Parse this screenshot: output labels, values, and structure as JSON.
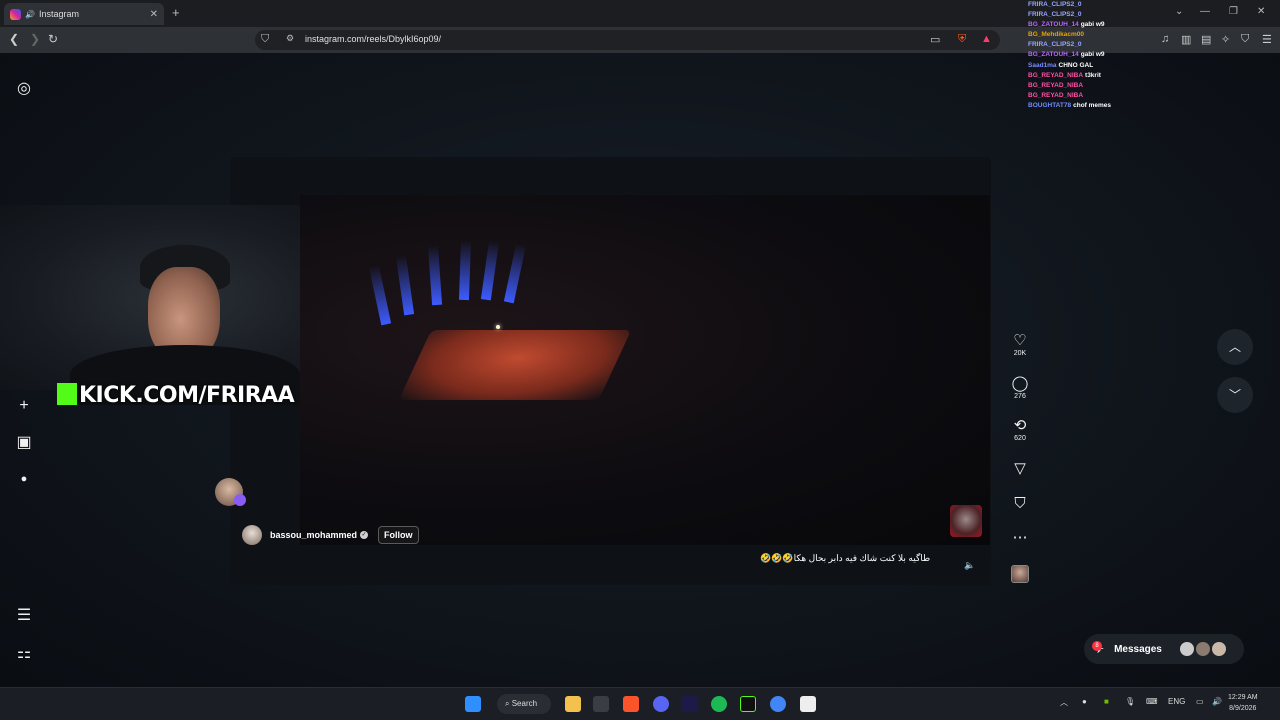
{
  "browser": {
    "tab_title": "Instagram",
    "url": "instagram.com/reels/DbylkI6op09/"
  },
  "chat": [
    {
      "user": "FRIRA_CLIPS2_0",
      "msg": "",
      "color": "#9aa7ff"
    },
    {
      "user": "FRIRA_CLIPS2_0",
      "msg": "",
      "color": "#9aa7ff"
    },
    {
      "user": "BG_ZATOUH_14",
      "msg": "gabi w9",
      "color": "#b964ff"
    },
    {
      "user": "BG_Mehdikacm00",
      "msg": "",
      "color": "#e8a300"
    },
    {
      "user": "FRIRA_CLIPS2_0",
      "msg": "",
      "color": "#9aa7ff"
    },
    {
      "user": "BG_ZATOUH_14",
      "msg": "gabi w9",
      "color": "#b964ff"
    },
    {
      "user": "Saad1ma",
      "msg": "CHNO GAL",
      "color": "#7a8bff"
    },
    {
      "user": "BG_REYAD_NIBA",
      "msg": "t3krit",
      "color": "#ff4fa3"
    },
    {
      "user": "BG_REYAD_NIBA",
      "msg": "",
      "color": "#ff4fa3"
    },
    {
      "user": "BG_REYAD_NIBA",
      "msg": "",
      "color": "#ff4fa3"
    },
    {
      "user": "BOUGHTAT78",
      "msg": "chof memes",
      "color": "#6f8cff"
    }
  ],
  "overlay": {
    "kick_text": "KICK.COM/FRIRAA"
  },
  "reel": {
    "owner": "bassou_mohammed",
    "follow_label": "Follow",
    "caption": "طاگيه بلا كنت شاك فيه دابر بحال هكا🤣🤣🤣"
  },
  "actions": {
    "likes": "20K",
    "comments": "276",
    "reposts": "620"
  },
  "messages": {
    "label": "Messages",
    "badge": "8"
  },
  "taskbar": {
    "search_label": "Search",
    "lang": "ENG",
    "time": "12:29 AM",
    "date": "8/9/2026"
  }
}
